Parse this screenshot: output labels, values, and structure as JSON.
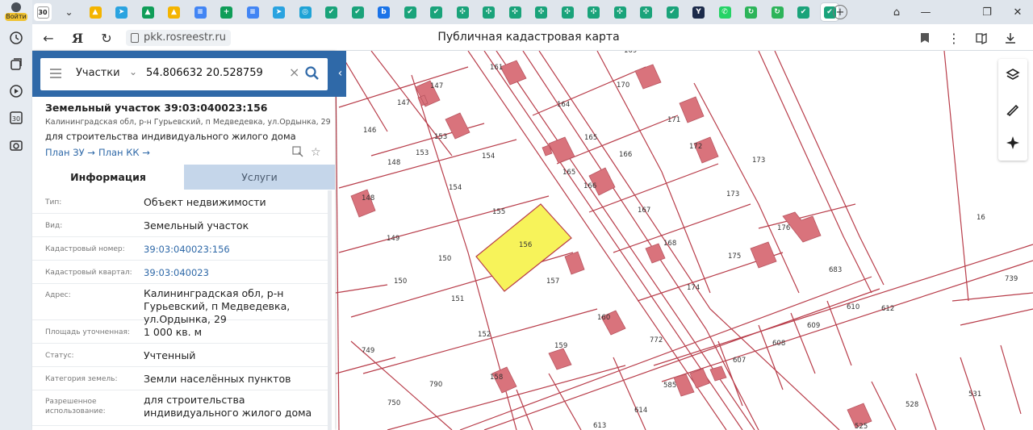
{
  "browser": {
    "profile_label": "Войти",
    "active_tab_label": "30",
    "url": "pkk.rosreestr.ru",
    "page_title": "Публичная кадастровая карта",
    "tab_icons": [
      {
        "name": "count-badge",
        "color": "#444",
        "glyph": "30"
      },
      {
        "name": "chevron-down-icon",
        "color": "#555",
        "glyph": "⌄"
      },
      {
        "name": "drive-icon",
        "color": "#f4b400",
        "glyph": "▲"
      },
      {
        "name": "telegram-icon",
        "color": "#2aa3e0",
        "glyph": "➤"
      },
      {
        "name": "drive-icon",
        "color": "#0f9d58",
        "glyph": "▲"
      },
      {
        "name": "drive-icon",
        "color": "#f4b400",
        "glyph": "▲"
      },
      {
        "name": "docs-icon",
        "color": "#4285f4",
        "glyph": "≡"
      },
      {
        "name": "sheets-icon",
        "color": "#0f9d58",
        "glyph": "+"
      },
      {
        "name": "docs-icon",
        "color": "#4285f4",
        "glyph": "≡"
      },
      {
        "name": "telegram-icon",
        "color": "#2aa3e0",
        "glyph": "➤"
      },
      {
        "name": "photo-icon",
        "color": "#1fa3d6",
        "glyph": "◎"
      },
      {
        "name": "shield-icon",
        "color": "#1aa37a",
        "glyph": "✔"
      },
      {
        "name": "shield-icon",
        "color": "#1aa37a",
        "glyph": "✔"
      },
      {
        "name": "b-icon",
        "color": "#1a73e8",
        "glyph": "b"
      },
      {
        "name": "shield-icon",
        "color": "#1aa37a",
        "glyph": "✔"
      },
      {
        "name": "shield-icon",
        "color": "#1aa37a",
        "glyph": "✔"
      },
      {
        "name": "dots-icon",
        "color": "#1aa37a",
        "glyph": "✣"
      },
      {
        "name": "dots-icon",
        "color": "#1aa37a",
        "glyph": "✣"
      },
      {
        "name": "dots-icon",
        "color": "#1aa37a",
        "glyph": "✣"
      },
      {
        "name": "dots-icon",
        "color": "#1aa37a",
        "glyph": "✣"
      },
      {
        "name": "dots-icon",
        "color": "#1aa37a",
        "glyph": "✣"
      },
      {
        "name": "dots-icon",
        "color": "#1aa37a",
        "glyph": "✣"
      },
      {
        "name": "dots-icon",
        "color": "#1aa37a",
        "glyph": "✣"
      },
      {
        "name": "dots-icon",
        "color": "#1aa37a",
        "glyph": "✣"
      },
      {
        "name": "shield-icon",
        "color": "#1aa37a",
        "glyph": "✔"
      },
      {
        "name": "y-icon",
        "color": "#1b2a4a",
        "glyph": "Y"
      },
      {
        "name": "whatsapp-icon",
        "color": "#25d366",
        "glyph": "✆"
      },
      {
        "name": "refresh-icon",
        "color": "#2db45a",
        "glyph": "↻"
      },
      {
        "name": "refresh-icon",
        "color": "#2db45a",
        "glyph": "↻"
      },
      {
        "name": "shield-icon",
        "color": "#1aa37a",
        "glyph": "✔"
      }
    ],
    "new_tab_glyph": "+"
  },
  "search": {
    "layer": "Участки",
    "query": "54.806632 20.528759"
  },
  "parcel": {
    "title": "Земельный участок 39:03:040023:156",
    "address_line": "Калининградская обл, р-н Гурьевский, п Медведевка, ул.Ордынка, 29",
    "purpose": "для строительства индивидуального жилого дома",
    "link_plan_zu": "План ЗУ",
    "link_plan_kk": "План КК",
    "tab_info": "Информация",
    "tab_services": "Услуги",
    "rows": [
      {
        "key": "Тип:",
        "value": "Объект недвижимости",
        "link": false
      },
      {
        "key": "Вид:",
        "value": "Земельный участок",
        "link": false
      },
      {
        "key": "Кадастровый номер:",
        "value": "39:03:040023:156",
        "link": true
      },
      {
        "key": "Кадастровый квартал:",
        "value": "39:03:040023",
        "link": true
      },
      {
        "key": "Адрес:",
        "value": "Калининградская обл, р-н Гурьевский, п Медведевка, ул.Ордынка, 29",
        "link": false
      },
      {
        "key": "Площадь уточненная:",
        "value": "1 000 кв. м",
        "link": false
      },
      {
        "key": "Статус:",
        "value": "Учтенный",
        "link": false
      },
      {
        "key": "Категория земель:",
        "value": "Земли населённых пунктов",
        "link": false
      },
      {
        "key": "Разрешенное использование:",
        "value": "для строительства индивидуального жилого дома",
        "link": false
      }
    ]
  },
  "map": {
    "colors": {
      "boundary": "#b83d4a",
      "building": "#d9737c",
      "selected": "#f7f35a",
      "label": "#333333"
    },
    "labels": [
      "147",
      "161",
      "169",
      "147",
      "164",
      "170",
      "146",
      "153",
      "165",
      "171",
      "148",
      "153",
      "154",
      "165",
      "166",
      "172",
      "173",
      "154",
      "166",
      "148",
      "155",
      "167",
      "173",
      "176",
      "16",
      "149",
      "156",
      "168",
      "175",
      "150",
      "150",
      "157",
      "174",
      "683",
      "739",
      "151",
      "160",
      "610",
      "609",
      "152",
      "772",
      "749",
      "159",
      "607",
      "608",
      "612",
      "158",
      "585",
      "750",
      "790",
      "613",
      "614",
      "531",
      "528",
      "525"
    ]
  }
}
